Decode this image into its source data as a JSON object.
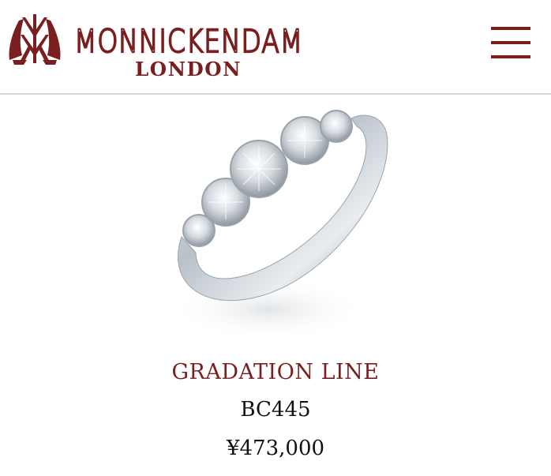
{
  "header": {
    "brand_name": "MONNICKENDAM",
    "brand_sub": "LONDON",
    "menu_icon": "hamburger-menu-icon",
    "accent_color": "#7a1f1f"
  },
  "product": {
    "name": "GRADATION LINE",
    "code": "BC445",
    "price": "¥473,000",
    "image_icon": "diamond-ring-image"
  }
}
